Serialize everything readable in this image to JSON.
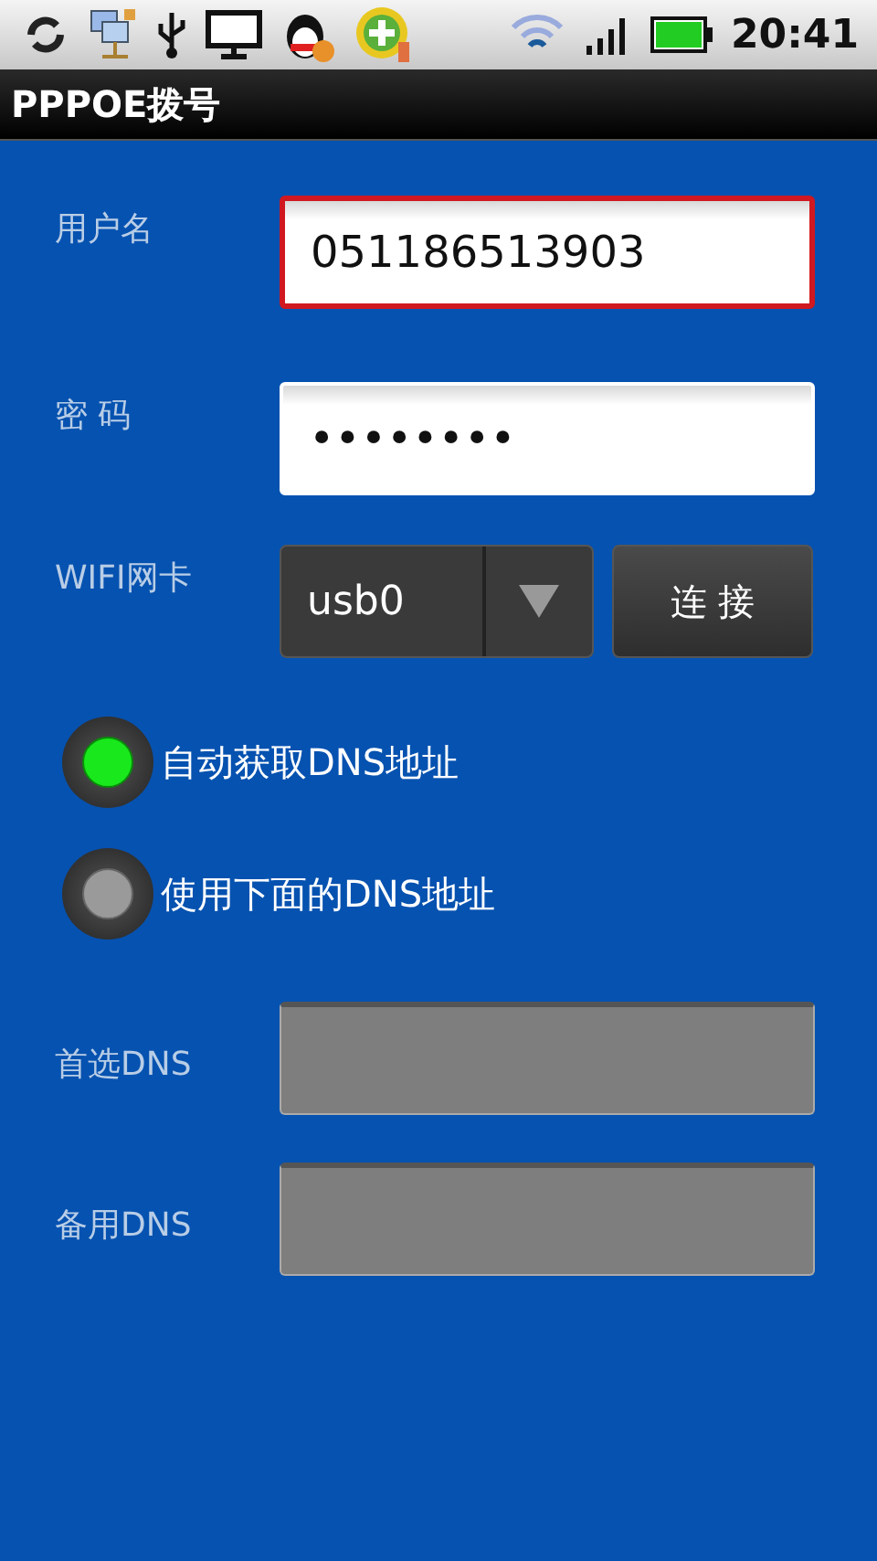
{
  "status_bar": {
    "time": "20:41"
  },
  "title": "PPPOE拨号",
  "username": {
    "label": "用户名",
    "value": "051186513903",
    "focused": true
  },
  "password": {
    "label": "密 码",
    "value": "••••••••",
    "focused": false
  },
  "wifi": {
    "label": "WIFI网卡",
    "value": "usb0"
  },
  "connect_button": "连 接",
  "dns_options": [
    {
      "label": "自动获取DNS地址",
      "selected": true
    },
    {
      "label": "使用下面的DNS地址",
      "selected": false
    }
  ],
  "dns_fields": [
    {
      "label": "首选DNS"
    },
    {
      "label": "备用DNS"
    }
  ]
}
